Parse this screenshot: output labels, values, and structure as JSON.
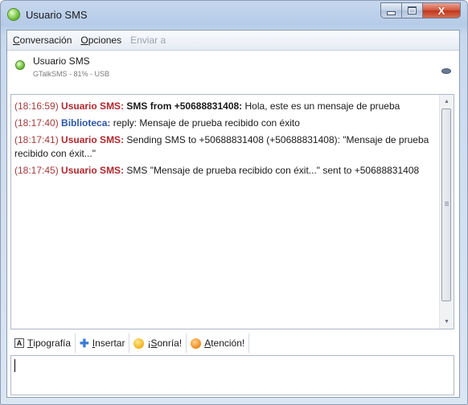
{
  "window": {
    "title": "Usuario SMS",
    "controls": {
      "minimize": "minimize",
      "maximize": "maximize",
      "close": "X"
    }
  },
  "menubar": {
    "items": [
      {
        "label": "Conversación",
        "ul": "C",
        "rest": "onversación",
        "enabled": true
      },
      {
        "label": "Opciones",
        "ul": "O",
        "rest": "pciones",
        "enabled": true
      },
      {
        "label": "Enviar a",
        "enabled": false
      }
    ]
  },
  "contact": {
    "name": "Usuario SMS",
    "status": "GTalkSMS - 81% - USB",
    "presence_icon": "online-dot-icon",
    "right_icon": "eye-icon"
  },
  "messages": [
    {
      "time": "(18:17:40)",
      "sender": "Biblioteca:",
      "sender_type": "local",
      "text": "reply: Mensaje de prueba recibido con éxito"
    }
  ],
  "msg1": {
    "time": "(18:16:59)",
    "sender": "Usuario SMS:",
    "bold_text": "SMS from +50688831408:",
    "text": "Hola, este es un mensaje de prueba"
  },
  "msg3": {
    "time": "(18:17:41)",
    "sender": "Usuario SMS:",
    "text": "Sending SMS to +50688831408 (+50688831408): \"Mensaje de prueba recibido con éxit...\""
  },
  "msg4": {
    "time": "(18:17:45)",
    "sender": "Usuario SMS:",
    "text": "SMS \"Mensaje de prueba recibido con éxit...\" sent to +50688831408"
  },
  "toolbar": {
    "tipografia": {
      "ul": "T",
      "rest": "ipografía",
      "icon": "font-icon"
    },
    "insertar": {
      "ul": "I",
      "rest": "nsertar",
      "icon": "plus-icon"
    },
    "sonria": {
      "pre": "¡",
      "ul": "S",
      "rest": "onría!",
      "icon": "smiley-icon"
    },
    "atencion": {
      "ul": "A",
      "rest": "tención!",
      "icon": "attention-icon"
    }
  },
  "input": {
    "value": ""
  },
  "colors": {
    "timestamp": "#a33a3a",
    "remote_sender": "#b1262c",
    "local_sender": "#2b56a8",
    "presence_online": "#7ac943"
  }
}
